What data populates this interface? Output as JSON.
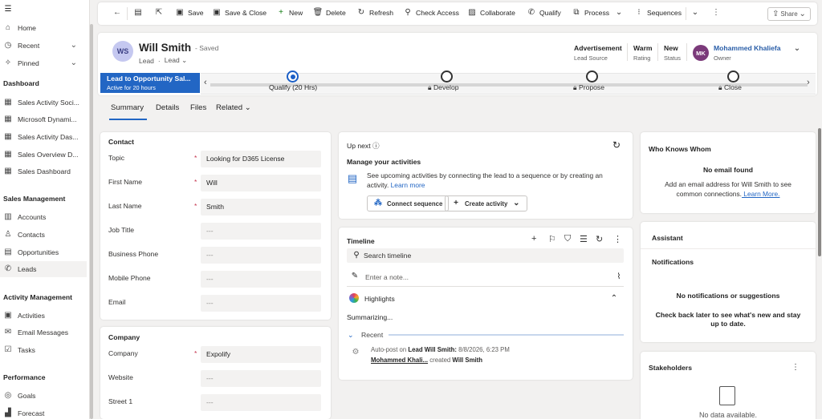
{
  "sidebar": {
    "items": [
      {
        "label": "Home",
        "icon": "home-icon"
      },
      {
        "label": "Recent",
        "icon": "clock-icon"
      },
      {
        "label": "Pinned",
        "icon": "pin-icon"
      }
    ],
    "groups": {
      "dashboard": "Dashboard",
      "sales_management": "Sales Management",
      "activity_management": "Activity Management",
      "performance": "Performance"
    },
    "dashboard_items": [
      {
        "label": "Sales Activity Soci..."
      },
      {
        "label": "Microsoft Dynami..."
      },
      {
        "label": "Sales Activity Das..."
      },
      {
        "label": "Sales Overview D..."
      },
      {
        "label": "Sales Dashboard"
      }
    ],
    "sales_items": [
      {
        "label": "Accounts"
      },
      {
        "label": "Contacts"
      },
      {
        "label": "Opportunities"
      },
      {
        "label": "Leads"
      }
    ],
    "activity_items": [
      {
        "label": "Activities"
      },
      {
        "label": "Email Messages"
      },
      {
        "label": "Tasks"
      }
    ],
    "performance_items": [
      {
        "label": "Goals"
      },
      {
        "label": "Forecast"
      }
    ]
  },
  "commandbar": {
    "save": "Save",
    "save_close": "Save & Close",
    "new": "New",
    "delete": "Delete",
    "refresh": "Refresh",
    "check_access": "Check Access",
    "collaborate": "Collaborate",
    "qualify": "Qualify",
    "process": "Process",
    "sequences": "Sequences",
    "share": "Share"
  },
  "header": {
    "avatar_initials": "WS",
    "name": "Will Smith",
    "saved_status": "- Saved",
    "entity": "Lead",
    "form": "Lead",
    "fields": [
      {
        "value": "Advertisement",
        "label": "Lead Source"
      },
      {
        "value": "Warm",
        "label": "Rating"
      },
      {
        "value": "New",
        "label": "Status"
      }
    ],
    "owner_initials": "MK",
    "owner_name": "Mohammed Khaliefa",
    "owner_label": "Owner",
    "owner_color": "#7b3a7a"
  },
  "bpf": {
    "process_name": "Lead to Opportunity Sal...",
    "active_for": "Active for 20 hours",
    "accent": "#2266c4",
    "stages": [
      {
        "label": "Qualify  (20 Hrs)"
      },
      {
        "label": "Develop"
      },
      {
        "label": "Propose"
      },
      {
        "label": "Close"
      }
    ]
  },
  "tabs": [
    "Summary",
    "Details",
    "Files",
    "Related"
  ],
  "contact": {
    "title": "Contact",
    "fields": [
      {
        "label": "Topic",
        "value": "Looking for D365 License"
      },
      {
        "label": "First Name",
        "value": "Will"
      },
      {
        "label": "Last Name",
        "value": "Smith"
      },
      {
        "label": "Job Title",
        "value": "---"
      },
      {
        "label": "Business Phone",
        "value": "---"
      },
      {
        "label": "Mobile Phone",
        "value": "---"
      },
      {
        "label": "Email",
        "value": "---"
      }
    ]
  },
  "company": {
    "title": "Company",
    "fields": [
      {
        "label": "Company",
        "value": "Expolify"
      },
      {
        "label": "Website",
        "value": "---"
      },
      {
        "label": "Street 1",
        "value": "---"
      }
    ]
  },
  "up_next": {
    "title": "Up next",
    "subtitle": "Manage your activities",
    "description": "See upcoming activities by connecting the lead to a sequence or by creating an activity.",
    "learn_more": "Learn more",
    "connect_sequence": "Connect sequence",
    "create_activity": "Create activity"
  },
  "timeline": {
    "title": "Timeline",
    "search_placeholder": "Search timeline",
    "note_placeholder": "Enter a note...",
    "highlights": "Highlights",
    "summarizing": "Summarizing...",
    "recent": "Recent",
    "post_prefix": "Auto-post on",
    "post_subject": "Lead Will Smith:",
    "post_date": "8/8/2026, 6:23 PM",
    "post_author": "Mohammed Khali...",
    "post_action": "created",
    "post_target": "Will Smith"
  },
  "who_knows_whom": {
    "title": "Who Knows Whom",
    "no_email": "No email found",
    "message": "Add an email address for Will Smith to see common connections.",
    "learn_more": " Learn More."
  },
  "assistant": {
    "title": "Assistant",
    "notifications": "Notifications",
    "empty_title": "No notifications or suggestions",
    "empty_message": "Check back later to see what's new and stay up to date."
  },
  "stakeholders": {
    "title": "Stakeholders",
    "empty": "No data available."
  }
}
